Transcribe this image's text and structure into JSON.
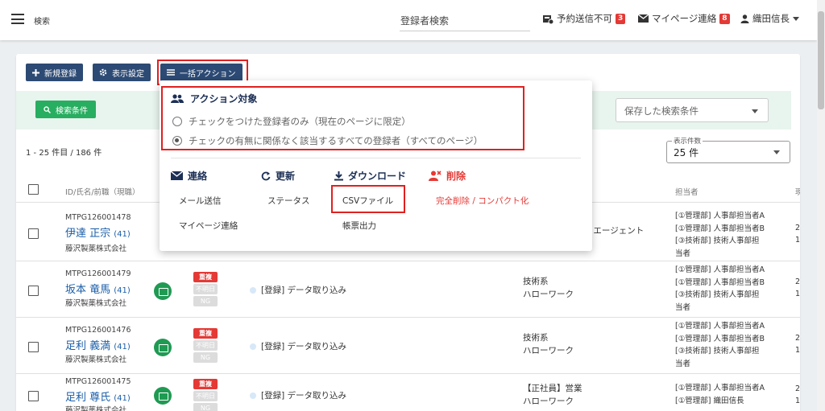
{
  "header": {
    "menu_label": "検索",
    "search_field": "登録者検索",
    "reserve_label": "予約送信不可",
    "reserve_count": "3",
    "mypage_label": "マイページ連絡",
    "mypage_count": "8",
    "user_name": "織田信長"
  },
  "toolbar": {
    "new_label": "新規登録",
    "display_label": "表示設定",
    "bulk_label": "一括アクション",
    "search_cond_label": "検索条件",
    "saved_search_placeholder": "保存した検索条件"
  },
  "list": {
    "count_text": "1 - 25 件目 / 186 件",
    "per_page_label": "表示件数",
    "per_page_value": "25 件",
    "col_id": "ID/氏名/前職（現職）",
    "col_manager": "担当者",
    "col_edge": "現"
  },
  "rows": [
    {
      "id": "MTPG126001478",
      "name": "伊達 正宗",
      "age": "(41)",
      "company": "藤沢製薬株式会社",
      "job_tail": "] エージェント",
      "managers": [
        "[①管理部] 人事部担当者A",
        "[①管理部] 人事部担当者B",
        "[③技術部] 技術人事部担",
        "当者"
      ],
      "edge": [
        "2",
        "1"
      ]
    },
    {
      "id": "MTPG126001479",
      "name": "坂本 竜馬",
      "age": "(41)",
      "company": "藤沢製薬株式会社",
      "tags": [
        "重複",
        "不明日",
        "NG"
      ],
      "route": "[登録] データ取り込み",
      "job": [
        "技術系",
        "ハローワーク"
      ],
      "managers": [
        "[①管理部] 人事部担当者A",
        "[①管理部] 人事部担当者B",
        "[③技術部] 技術人事部担",
        "当者"
      ],
      "edge": [
        "2",
        "1"
      ]
    },
    {
      "id": "MTPG126001476",
      "name": "足利 義満",
      "age": "(41)",
      "company": "藤沢製薬株式会社",
      "tags": [
        "重複",
        "不明日",
        "NG"
      ],
      "route": "[登録] データ取り込み",
      "job": [
        "技術系",
        "ハローワーク"
      ],
      "managers": [
        "[①管理部] 人事部担当者A",
        "[①管理部] 人事部担当者B",
        "[③技術部] 技術人事部担",
        "当者"
      ],
      "edge": [
        "2",
        "1"
      ]
    },
    {
      "id": "MTPG126001475",
      "name": "足利 尊氏",
      "age": "(41)",
      "company": "藤沢製薬株式会社",
      "tags": [
        "重複",
        "不明日",
        "NG"
      ],
      "route": "[登録] データ取り込み",
      "job": [
        "【正社員】営業",
        "ハローワーク"
      ],
      "managers": [
        "[①管理部] 人事部担当者A",
        "[①管理部] 織田信長"
      ],
      "edge": [
        "2",
        "1"
      ]
    }
  ],
  "bulk_menu": {
    "target_title": "アクション対象",
    "option_checked": "チェックをつけた登録者のみ（現在のページに限定）",
    "option_all": "チェックの有無に関係なく該当するすべての登録者（すべてのページ）",
    "sections": {
      "contact": {
        "title": "連絡",
        "items": [
          "メール送信",
          "マイページ連絡"
        ]
      },
      "update": {
        "title": "更新",
        "items": [
          "ステータス"
        ]
      },
      "download": {
        "title": "ダウンロード",
        "items": [
          "CSVファイル",
          "帳票出力"
        ]
      },
      "delete": {
        "title": "削除",
        "items": [
          "完全削除 / コンパクト化"
        ]
      }
    }
  },
  "colors": {
    "navy": "#2c4a74",
    "green": "#27ae60",
    "red": "#e53935",
    "link": "#1a5ea8"
  },
  "icons": [
    "menu-icon",
    "plus-icon",
    "gear-icon",
    "list-icon",
    "search-icon",
    "people-icon",
    "mail-icon",
    "refresh-icon",
    "download-icon",
    "delete-user-icon",
    "user-icon",
    "card-icon"
  ]
}
